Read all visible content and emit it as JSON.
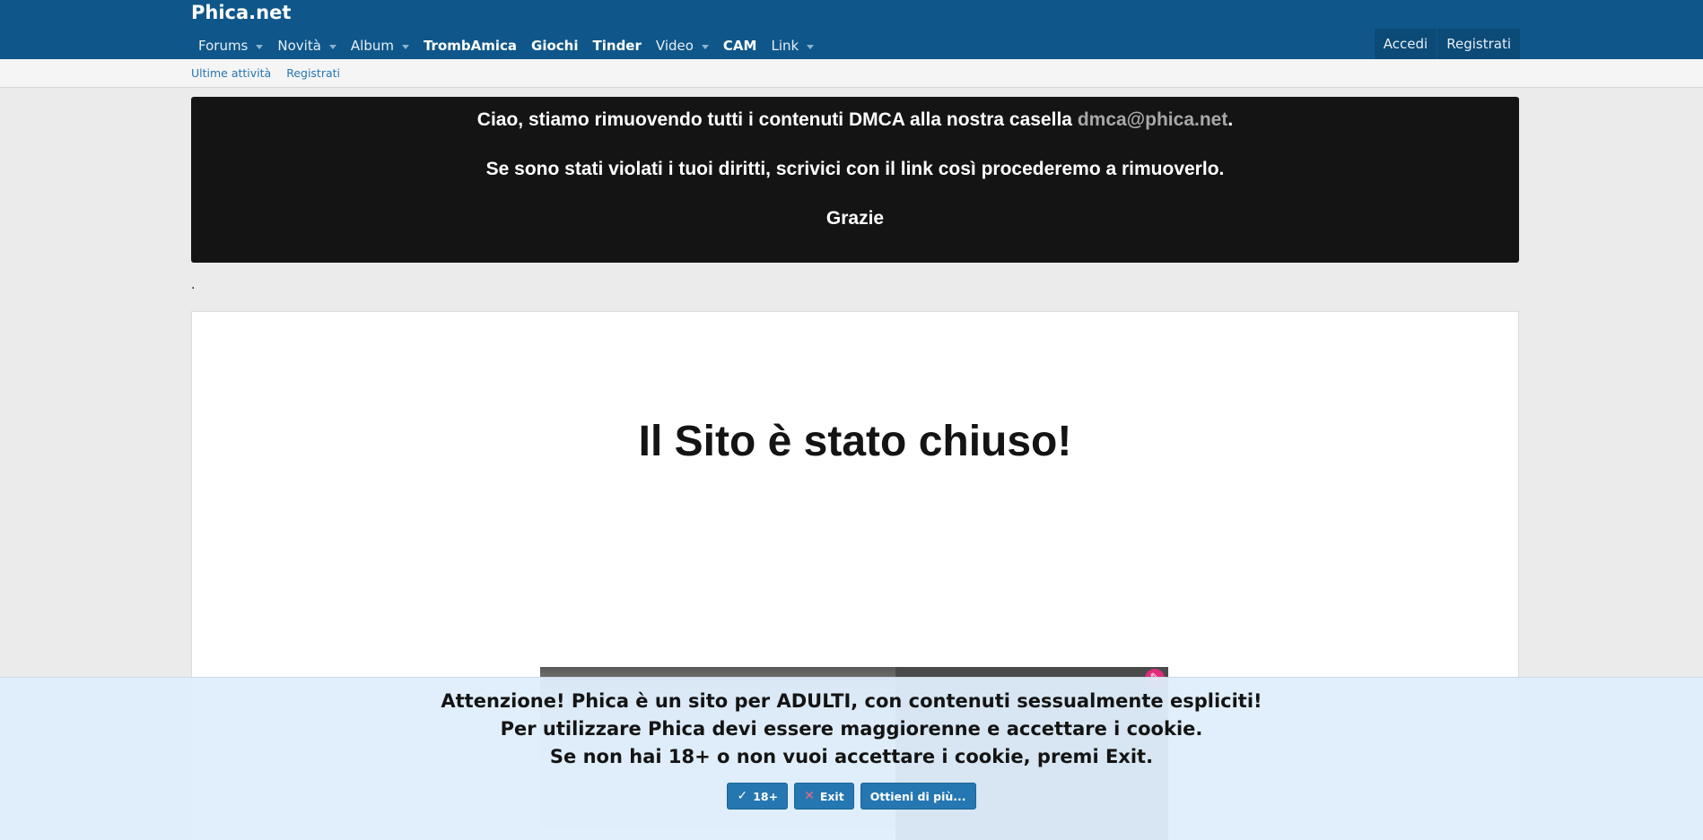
{
  "header": {
    "logo": "Phica.net",
    "nav": [
      {
        "label": "Forums",
        "caret": true,
        "bold": false
      },
      {
        "label": "Novità",
        "caret": true,
        "bold": false
      },
      {
        "label": "Album",
        "caret": true,
        "bold": false
      },
      {
        "label": "TrombAmica",
        "caret": false,
        "bold": true
      },
      {
        "label": "Giochi",
        "caret": false,
        "bold": true
      },
      {
        "label": "Tinder",
        "caret": false,
        "bold": true
      },
      {
        "label": "Video",
        "caret": true,
        "bold": false
      },
      {
        "label": "CAM",
        "caret": false,
        "bold": true
      },
      {
        "label": "Link",
        "caret": true,
        "bold": false
      }
    ],
    "login_label": "Accedi",
    "register_label": "Registrati"
  },
  "subnav": {
    "latest_activity": "Ultime attività",
    "register": "Registrati"
  },
  "dmca_notice": {
    "line1_prefix": "Ciao, stiamo rimuovendo tutti i contenuti DMCA alla nostra casella",
    "email": "dmca@phica.net",
    "line1_suffix": ".",
    "line2": "Se sono stati violati i tuoi diritti, scrivici con il link così procederemo a rimuoverlo.",
    "line3": "Grazie"
  },
  "dot": ".",
  "main": {
    "title": "Il Sito è stato chiuso!"
  },
  "consent": {
    "line1": "Attenzione! Phica è un sito per ADULTI, con contenuti sessualmente espliciti!",
    "line2": "Per utilizzare Phica devi essere maggiorenne e accettare i cookie.",
    "line3": "Se non hai 18+ o non vuoi accettare i cookie, premi Exit.",
    "accept_label": "18+",
    "exit_label": "Exit",
    "more_label": "Ottieni di più..."
  },
  "colors": {
    "header_bg": "#0f578a",
    "link": "#2577b1",
    "notice_bg": "#141414",
    "consent_bg": "#deeefb"
  }
}
